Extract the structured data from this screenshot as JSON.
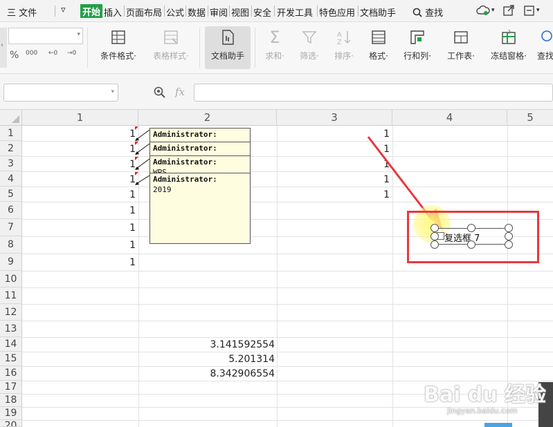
{
  "menubar": {
    "hamburger_label": "三 文件",
    "tabs": [
      "开始",
      "插入",
      "页面布局",
      "公式",
      "数据",
      "审阅",
      "视图",
      "安全",
      "开发工具",
      "特色应用",
      "文档助手"
    ],
    "active_tab": "开始",
    "search_label": "查找"
  },
  "ribbon": {
    "num_formats": [
      "%",
      "000",
      "←0",
      "→0"
    ],
    "buttons": [
      {
        "label": "条件格式·",
        "enabled": true
      },
      {
        "label": "表格样式·",
        "enabled": false
      },
      {
        "label": "文档助手",
        "enabled": true
      },
      {
        "label": "求和·",
        "enabled": false
      },
      {
        "label": "筛选·",
        "enabled": false
      },
      {
        "label": "排序·",
        "enabled": false
      },
      {
        "label": "格式·",
        "enabled": true
      },
      {
        "label": "行和列·",
        "enabled": true
      },
      {
        "label": "工作表·",
        "enabled": true
      },
      {
        "label": "冻结窗格·",
        "enabled": true
      },
      {
        "label": "查找",
        "enabled": true
      }
    ]
  },
  "formula_bar": {
    "fx_label": "fx",
    "name_box_value": "",
    "formula_value": ""
  },
  "sheet": {
    "columns": [
      "1",
      "2",
      "3",
      "4",
      "5"
    ],
    "rows": [
      "1",
      "2",
      "3",
      "4",
      "5",
      "6",
      "7",
      "8",
      "9",
      "10",
      "11",
      "12",
      "13",
      "14",
      "15",
      "16",
      "17",
      "18",
      "19",
      "20"
    ],
    "col1_values": [
      "1",
      "1",
      "1",
      "1",
      "1",
      "1",
      "1",
      "1",
      "1"
    ],
    "col3_values": [
      "1",
      "1",
      "1",
      "1",
      "1"
    ],
    "col2_values": {
      "r14": "3.141592554",
      "r15": "5.201314",
      "r16": "8.342906554"
    }
  },
  "comments": [
    {
      "author": "Administrator:",
      "text": ""
    },
    {
      "author": "Administrator:",
      "text": ""
    },
    {
      "author": "Administrator:",
      "text": "WPS"
    },
    {
      "author": "Administrator:",
      "text": "2019"
    }
  ],
  "checkbox": {
    "label": "复选框 7"
  },
  "watermark": {
    "brand": "Bai du 经验",
    "url": "jingyan.baidu.com"
  },
  "colors": {
    "accent": "#22a047",
    "highlight_box": "#e8383d",
    "arrow": "#e8383d",
    "comment_bg": "#fffde0"
  }
}
